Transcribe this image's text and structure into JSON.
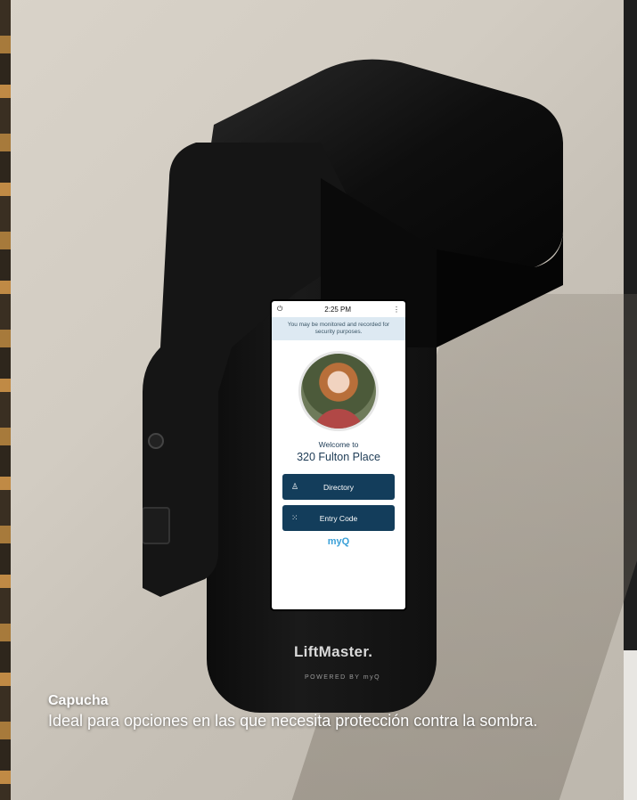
{
  "screen": {
    "time": "2:25 PM",
    "notice": "You may be monitored and recorded for security purposes.",
    "welcome": "Welcome to",
    "place": "320 Fulton Place",
    "buttons": [
      {
        "label": "Directory",
        "icon": "person-icon"
      },
      {
        "label": "Entry Code",
        "icon": "keypad-icon"
      }
    ],
    "logo": "myQ"
  },
  "device": {
    "brand": "LiftMaster.",
    "powered_by": "POWERED BY myQ"
  },
  "caption": {
    "title": "Capucha",
    "description": "Ideal para opciones en las que necesita protección contra la sombra."
  },
  "colors": {
    "button": "#133d5b",
    "notice_bg": "#dde9f2",
    "myq_blue": "#3aa0d8"
  }
}
